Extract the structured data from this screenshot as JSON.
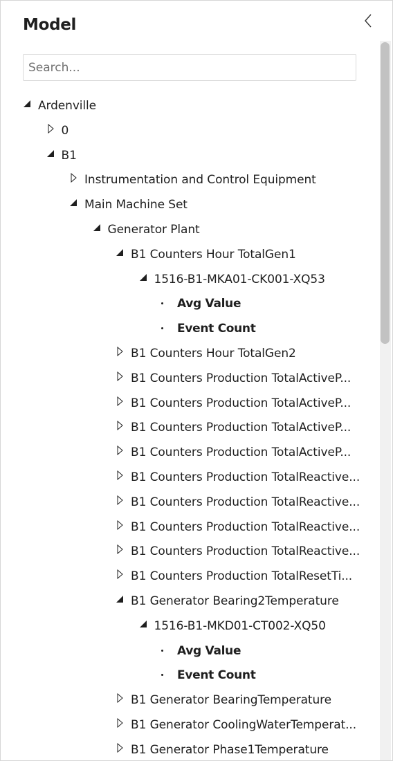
{
  "panel": {
    "title": "Model",
    "collapse_icon": "chevron-left-icon"
  },
  "search": {
    "placeholder": "Search...",
    "value": ""
  },
  "tree": [
    {
      "label": "Ardenville",
      "level": 0,
      "state": "expanded"
    },
    {
      "label": "0",
      "level": 1,
      "state": "collapsed"
    },
    {
      "label": "B1",
      "level": 1,
      "state": "expanded"
    },
    {
      "label": "Instrumentation and Control Equipment",
      "level": 2,
      "state": "collapsed"
    },
    {
      "label": "Main Machine Set",
      "level": 2,
      "state": "expanded"
    },
    {
      "label": "Generator Plant",
      "level": 3,
      "state": "expanded"
    },
    {
      "label": "B1 Counters Hour TotalGen1",
      "level": 4,
      "state": "expanded"
    },
    {
      "label": "1516-B1-MKA01-CK001-XQ53",
      "level": 5,
      "state": "expanded"
    },
    {
      "label": "Avg Value",
      "level": 6,
      "state": "leaf"
    },
    {
      "label": "Event Count",
      "level": 6,
      "state": "leaf"
    },
    {
      "label": "B1 Counters Hour TotalGen2",
      "level": 4,
      "state": "collapsed"
    },
    {
      "label": "B1 Counters Production TotalActiveP...",
      "level": 4,
      "state": "collapsed"
    },
    {
      "label": "B1 Counters Production TotalActiveP...",
      "level": 4,
      "state": "collapsed"
    },
    {
      "label": "B1 Counters Production TotalActiveP...",
      "level": 4,
      "state": "collapsed"
    },
    {
      "label": "B1 Counters Production TotalActiveP...",
      "level": 4,
      "state": "collapsed"
    },
    {
      "label": "B1 Counters Production TotalReactive...",
      "level": 4,
      "state": "collapsed"
    },
    {
      "label": "B1 Counters Production TotalReactive...",
      "level": 4,
      "state": "collapsed"
    },
    {
      "label": "B1 Counters Production TotalReactive...",
      "level": 4,
      "state": "collapsed"
    },
    {
      "label": "B1 Counters Production TotalReactive...",
      "level": 4,
      "state": "collapsed"
    },
    {
      "label": "B1 Counters Production TotalResetTi...",
      "level": 4,
      "state": "collapsed"
    },
    {
      "label": "B1 Generator Bearing2Temperature",
      "level": 4,
      "state": "expanded"
    },
    {
      "label": "1516-B1-MKD01-CT002-XQ50",
      "level": 5,
      "state": "expanded"
    },
    {
      "label": "Avg Value",
      "level": 6,
      "state": "leaf"
    },
    {
      "label": "Event Count",
      "level": 6,
      "state": "leaf"
    },
    {
      "label": "B1 Generator BearingTemperature",
      "level": 4,
      "state": "collapsed"
    },
    {
      "label": "B1 Generator CoolingWaterTemperat...",
      "level": 4,
      "state": "collapsed"
    },
    {
      "label": "B1 Generator Phase1Temperature",
      "level": 4,
      "state": "collapsed"
    }
  ],
  "icons": {
    "expanded": "triangle-expanded-icon",
    "collapsed": "triangle-collapsed-icon",
    "leaf": "bullet-dot-icon"
  },
  "colors": {
    "text": "#1f1f1f",
    "border": "#d6d6d6",
    "scroll_thumb": "#c2c2c2",
    "scroll_track": "#f1f1f1"
  }
}
